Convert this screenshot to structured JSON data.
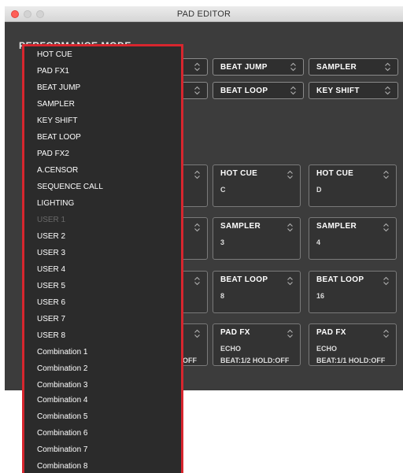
{
  "window": {
    "title": "PAD EDITOR"
  },
  "section": {
    "label": "PERFORMANCE MODE"
  },
  "mode_selects": [
    {
      "label": "BEAT JUMP"
    },
    {
      "label": "SAMPLER"
    },
    {
      "label": "BEAT LOOP"
    },
    {
      "label": "KEY SHIFT"
    }
  ],
  "pads": [
    {
      "title": "HOT CUE",
      "value": "C",
      "value2": ""
    },
    {
      "title": "HOT CUE",
      "value": "D",
      "value2": ""
    },
    {
      "title": "SAMPLER",
      "value": "3",
      "value2": ""
    },
    {
      "title": "SAMPLER",
      "value": "4",
      "value2": ""
    },
    {
      "title": "BEAT LOOP",
      "value": "8",
      "value2": ""
    },
    {
      "title": "BEAT LOOP",
      "value": "16",
      "value2": ""
    },
    {
      "title": "PAD FX",
      "value": "ECHO",
      "value2": "BEAT:1/2 HOLD:OFF"
    },
    {
      "title": "PAD FX",
      "value": "ECHO",
      "value2": "BEAT:1/1 HOLD:OFF"
    }
  ],
  "clipped_text": "OFF",
  "dropdown": {
    "items": [
      {
        "label": "HOT CUE",
        "disabled": false
      },
      {
        "label": "PAD FX1",
        "disabled": false
      },
      {
        "label": "BEAT JUMP",
        "disabled": false
      },
      {
        "label": "SAMPLER",
        "disabled": false
      },
      {
        "label": "KEY SHIFT",
        "disabled": false
      },
      {
        "label": "BEAT LOOP",
        "disabled": false
      },
      {
        "label": "PAD FX2",
        "disabled": false
      },
      {
        "label": "A.CENSOR",
        "disabled": false
      },
      {
        "label": "SEQUENCE CALL",
        "disabled": false
      },
      {
        "label": "LIGHTING",
        "disabled": false
      },
      {
        "label": "USER 1",
        "disabled": true
      },
      {
        "label": "USER 2",
        "disabled": false
      },
      {
        "label": "USER 3",
        "disabled": false
      },
      {
        "label": "USER 4",
        "disabled": false
      },
      {
        "label": "USER 5",
        "disabled": false
      },
      {
        "label": "USER 6",
        "disabled": false
      },
      {
        "label": "USER 7",
        "disabled": false
      },
      {
        "label": "USER 8",
        "disabled": false
      },
      {
        "label": "Combination 1",
        "disabled": false
      },
      {
        "label": "Combination 2",
        "disabled": false
      },
      {
        "label": "Combination 3",
        "disabled": false
      },
      {
        "label": "Combination 4",
        "disabled": false
      },
      {
        "label": "Combination 5",
        "disabled": false
      },
      {
        "label": "Combination 6",
        "disabled": false
      },
      {
        "label": "Combination 7",
        "disabled": false
      },
      {
        "label": "Combination 8",
        "disabled": false
      }
    ]
  },
  "colors": {
    "panel_bg": "#3c3c3c",
    "highlight_border": "#d7262e",
    "close_button": "#fe5f57",
    "disabled_text": "#6a6a6a"
  }
}
